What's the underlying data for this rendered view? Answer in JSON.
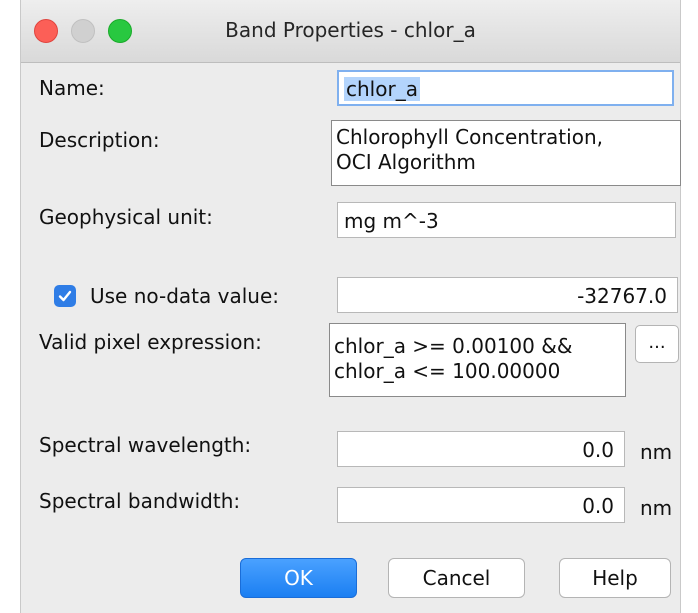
{
  "window": {
    "title": "Band Properties - chlor_a"
  },
  "form": {
    "name_label": "Name:",
    "name_value": "chlor_a",
    "description_label": "Description:",
    "description_value": "Chlorophyll Concentration,\nOCI Algorithm",
    "unit_label": "Geophysical unit:",
    "unit_value": "mg m^-3",
    "nodata_checkbox_label": "Use no-data value:",
    "nodata_checked": true,
    "nodata_value": "-32767.0",
    "valid_expr_label": "Valid pixel expression:",
    "valid_expr_value": "chlor_a >= 0.00100 &&\nchlor_a <= 100.00000",
    "expr_button_label": "...",
    "wavelength_label": "Spectral wavelength:",
    "wavelength_value": "0.0",
    "wavelength_unit": "nm",
    "bandwidth_label": "Spectral bandwidth:",
    "bandwidth_value": "0.0",
    "bandwidth_unit": "nm"
  },
  "buttons": {
    "ok": "OK",
    "cancel": "Cancel",
    "help": "Help"
  },
  "colors": {
    "accent": "#2f7de6",
    "close": "#fc5f57",
    "zoom": "#28c840"
  }
}
